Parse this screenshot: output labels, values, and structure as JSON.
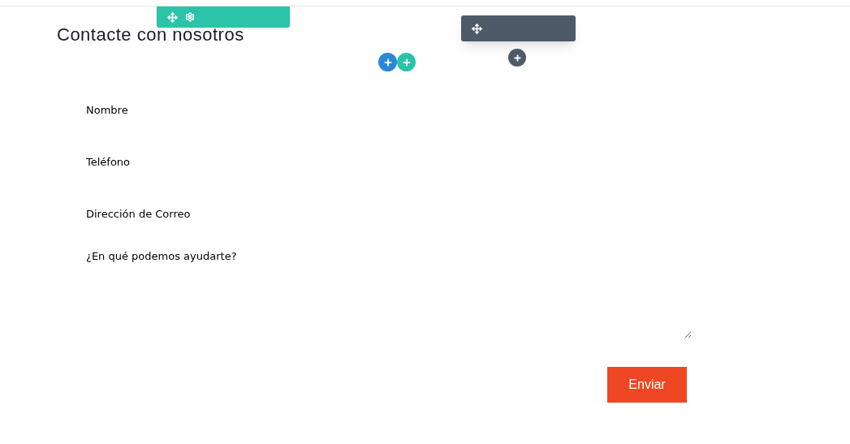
{
  "heading": "Contacte con nosotros",
  "fields": [
    {
      "kind": "input",
      "placeholder": "Nombre"
    },
    {
      "kind": "input",
      "placeholder": "Teléfono"
    },
    {
      "kind": "input",
      "placeholder": "Dirección de Correo"
    },
    {
      "kind": "textarea",
      "placeholder": "¿En qué podemos ayudarte?"
    }
  ],
  "submit": "Enviar"
}
